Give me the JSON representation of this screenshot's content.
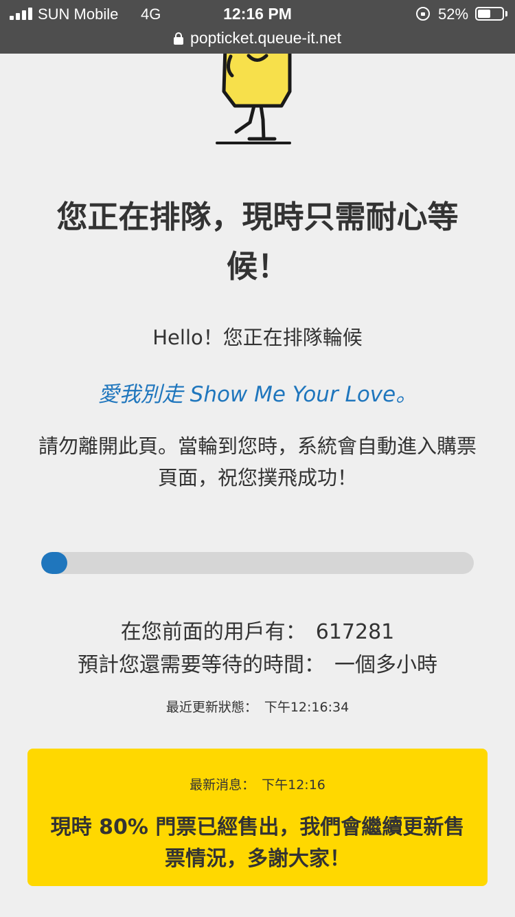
{
  "status_bar": {
    "carrier": "SUN Mobile",
    "network": "4G",
    "time": "12:16 PM",
    "battery_percent": "52%",
    "battery_level": 0.52,
    "url": "popticket.queue-it.net"
  },
  "content": {
    "title": "您正在排隊，現時只需耐心等候！",
    "greeting": "Hello！您正在排隊輪候",
    "event_name": "愛我別走 Show Me Your Love。",
    "instruction": "請勿離開此頁。當輪到您時，系統會自動進入購票頁面，祝您撲飛成功！"
  },
  "progress": {
    "value_percent": 6
  },
  "queue": {
    "ahead_label": "在您前面的用戶有：",
    "ahead_value": "617281",
    "wait_label": "預計您還需要等待的時間：",
    "wait_value": "一個多小時",
    "updated_label": "最近更新狀態：",
    "updated_value": "下午12:16:34"
  },
  "message": {
    "label": "最新消息：",
    "time": "下午12:16",
    "text": "現時 80% 門票已經售出，我們會繼續更新售票情況，多謝大家！"
  },
  "colors": {
    "accent": "#1f76bd",
    "message_bg": "#ffd800",
    "mascot": "#f7e04b"
  }
}
